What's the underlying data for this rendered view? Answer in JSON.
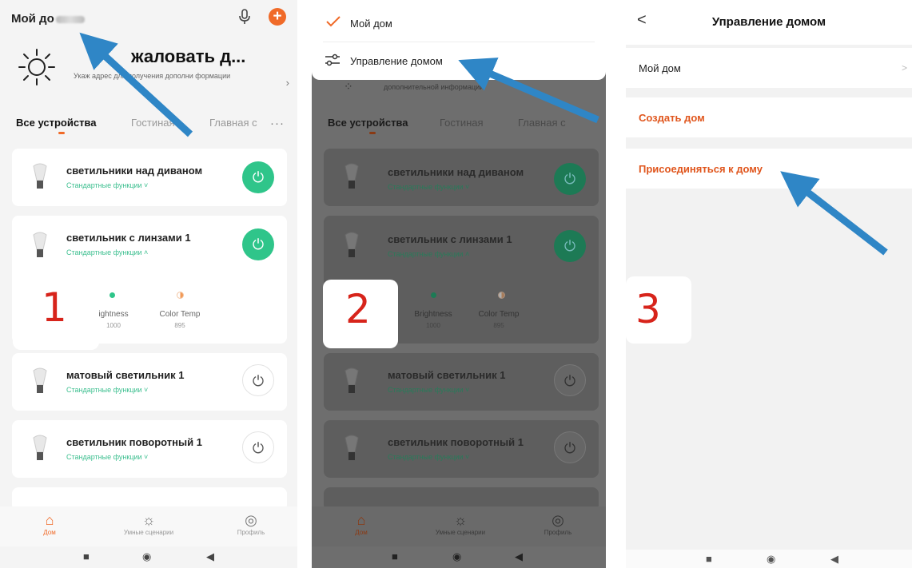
{
  "panel1": {
    "home_title": "Мой до",
    "weather_big": "жаловать д...",
    "weather_small": "Укаж        адрес для получения дополни          формации",
    "tabs": [
      "Все устройства",
      "Гостиная",
      "Главная с"
    ],
    "more": "···",
    "devices": [
      {
        "name": "светильники над диваном",
        "func": "Стандартные функции ˅",
        "power": "on"
      },
      {
        "name": "светильник с линзами 1",
        "func": "Стандартные функции ˄",
        "power": "on"
      },
      {
        "name": "матовый светильник 1",
        "func": "Стандартные функции ˅",
        "power": "off"
      },
      {
        "name": "светильник поворотный 1",
        "func": "Стандартные функции ˅",
        "power": "off"
      }
    ],
    "brightness_label": "ightness",
    "brightness_value": "1000",
    "colortemp_label": "Color Temp",
    "colortemp_value": "895",
    "step": "1"
  },
  "panel2": {
    "menu_item_1": "Мой дом",
    "menu_item_2": "Управление домом",
    "dim_small": "дополнительной информации",
    "tabs": [
      "Все устройства",
      "Гостиная",
      "Главная с"
    ],
    "devices": [
      {
        "name": "светильники над диваном",
        "func": "Стандартные функции ˅"
      },
      {
        "name": "светильник с линзами 1",
        "func": "Стандартные функции ˄"
      },
      {
        "name": "матовый светильник 1",
        "func": "Стандартные функции ˅"
      },
      {
        "name": "светильник поворотный 1",
        "func": "Стандартные функции ˅"
      }
    ],
    "brightness_label": "Brightness",
    "brightness_value": "1000",
    "colortemp_label": "Color Temp",
    "colortemp_value": "895",
    "step": "2"
  },
  "panel3": {
    "back": "<",
    "title": "Управление домом",
    "row_my_home": "Мой дом",
    "row_create": "Создать дом",
    "row_join": "Присоединяться к дому",
    "chevron": ">",
    "step": "3"
  },
  "nav": {
    "home": "Дом",
    "scenes": "Умные сценарии",
    "profile": "Профиль"
  },
  "colors": {
    "accent_orange": "#f06a28",
    "power_green": "#2fc58a",
    "arrow_blue": "#2f86c6",
    "step_red": "#d7241b"
  }
}
